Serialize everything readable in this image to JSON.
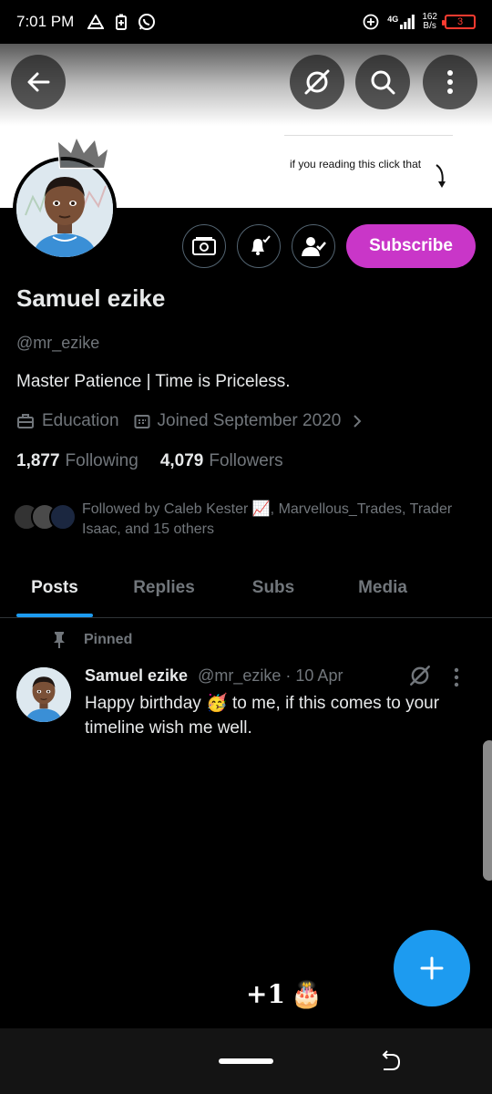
{
  "status_bar": {
    "time": "7:01 PM",
    "network": "4G",
    "speed_value": "162",
    "speed_unit": "B/s",
    "battery": "3",
    "icons": [
      "drive-icon",
      "battery-saver-icon",
      "whatsapp-icon",
      "data-saver-icon",
      "signal-icon"
    ]
  },
  "banner": {
    "note_text": "if you reading this click that"
  },
  "profile": {
    "name": "Samuel ezike",
    "handle": "@mr_ezike",
    "bio": "Master Patience | Time is Priceless.",
    "category": "Education",
    "joined": "Joined September 2020",
    "following_count": "1,877",
    "following_label": "Following",
    "followers_count": "4,079",
    "followers_label": "Followers",
    "followed_by": "Followed by Caleb Kester 📈, Marvellous_Trades, Trader Isaac, and 15 others"
  },
  "actions": {
    "subscribe_label": "Subscribe"
  },
  "tabs": [
    {
      "label": "Posts",
      "active": true
    },
    {
      "label": "Replies",
      "active": false
    },
    {
      "label": "Subs",
      "active": false
    },
    {
      "label": "Media",
      "active": false
    }
  ],
  "pinned_post": {
    "pinned_label": "Pinned",
    "author": "Samuel ezike",
    "handle": "@mr_ezike",
    "separator": "·",
    "date": "10 Apr",
    "text": "Happy birthday 🥳 to me, if this comes to your timeline wish me well."
  },
  "birthday_badge": {
    "label": "+1",
    "emoji": "🎂"
  },
  "colors": {
    "background": "#000000",
    "accent": "#1d9bf0",
    "subscribe": "#c936c8",
    "muted_text": "#71767b",
    "text": "#e7e9ea"
  }
}
